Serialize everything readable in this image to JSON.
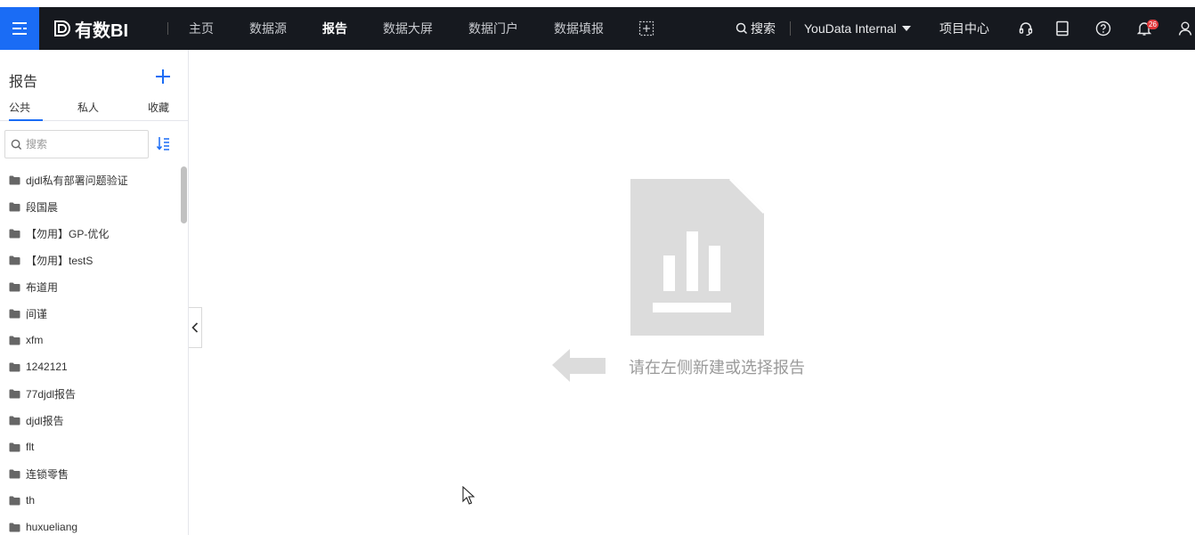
{
  "app": {
    "brand": "有数BI",
    "nav": [
      "主页",
      "数据源",
      "报告",
      "数据大屏",
      "数据门户",
      "数据填报"
    ],
    "active_nav": "报告",
    "search_label": "搜索",
    "org_name": "YouData Internal",
    "project_center": "项目中心",
    "notification_count": "26"
  },
  "sidebar": {
    "title": "报告",
    "tabs": [
      "公共",
      "私人",
      "收藏"
    ],
    "active_tab": "公共",
    "search_placeholder": "搜索",
    "items": [
      "djdl私有部署问题验证",
      "段国晨",
      "【勿用】GP-优化",
      "【勿用】testS",
      "布道用",
      "间谨",
      "xfm",
      "1242121",
      "77djdl报告",
      "djdl报告",
      "flt",
      "连锁零售",
      "th",
      "huxueliang"
    ]
  },
  "main": {
    "empty_message": "请在左侧新建或选择报告"
  },
  "colors": {
    "topbar_bg": "#16191f",
    "accent": "#1a6cf5",
    "badge": "#e4393c",
    "placeholder_gray": "#d9d9d9"
  }
}
